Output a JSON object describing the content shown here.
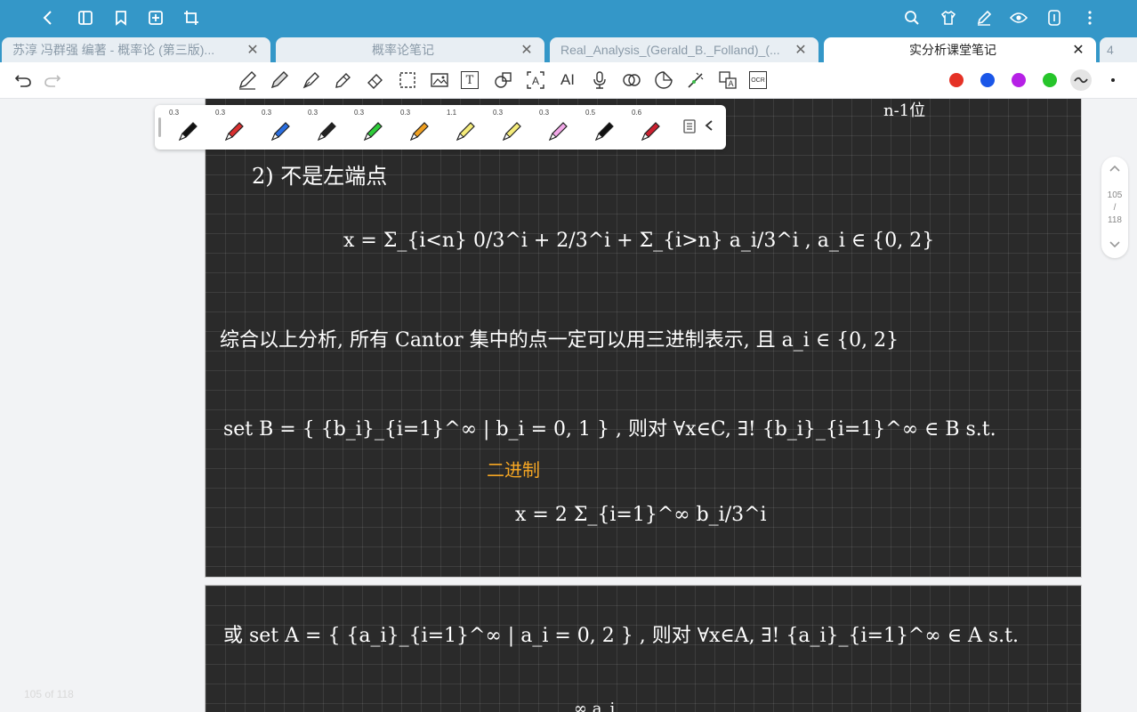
{
  "topbar": {
    "left_icons": [
      "back-icon",
      "book-icon",
      "bookmark-icon",
      "add-page-icon",
      "crop-icon"
    ],
    "right_icons": [
      "search-icon",
      "shirt-icon",
      "pen-icon",
      "eye-icon",
      "split-view-icon",
      "more-icon"
    ]
  },
  "tabs": [
    {
      "label": "苏淳 冯群强 编著 - 概率论 (第三版)...",
      "active": false
    },
    {
      "label": "概率论笔记",
      "active": false
    },
    {
      "label": "Real_Analysis_(Gerald_B._Folland)_(...",
      "active": false
    },
    {
      "label": "实分析课堂笔记",
      "active": true
    }
  ],
  "tab_count": "4",
  "toolbar": {
    "tools": [
      "pencil-icon",
      "pen-icon",
      "fountain-pen-icon",
      "highlighter-icon",
      "eraser-icon",
      "lasso-icon",
      "image-icon",
      "text-icon",
      "shapes-icon",
      "ocr-text-icon",
      "ai-icon",
      "microphone-icon",
      "link-icon",
      "sticker-icon",
      "laser-icon",
      "translate-icon",
      "ocr-icon"
    ],
    "tool_labels": {
      "text": "T",
      "ai": "AI",
      "ocr": "OCR"
    },
    "colors": [
      "#e53125",
      "#1a56e8",
      "#b620e6",
      "#26c52a"
    ]
  },
  "pen_panel": {
    "pens": [
      {
        "size": "0.3",
        "color": "#111111"
      },
      {
        "size": "0.3",
        "color": "#d93030"
      },
      {
        "size": "0.3",
        "color": "#2a6ee0"
      },
      {
        "size": "0.3",
        "color": "#222222"
      },
      {
        "size": "0.3",
        "color": "#2ecc3a"
      },
      {
        "size": "0.3",
        "color": "#f0a020"
      },
      {
        "size": "1.1",
        "color": "#f5ec7a"
      },
      {
        "size": "0.3",
        "color": "#f5ec7a"
      },
      {
        "size": "0.3",
        "color": "#f2a8e8"
      },
      {
        "size": "0.5",
        "color": "#111111"
      },
      {
        "size": "0.6",
        "color": "#cc2030"
      }
    ]
  },
  "scroller": {
    "current": "105",
    "separator": "/",
    "total": "118"
  },
  "page_indicator": "105 of 118",
  "note": {
    "top_fragment": "n-1位",
    "case2": "2) 不是左端点",
    "formula1": "x = Σ_{i<n} 0/3^i + 2/3^i + Σ_{i>n} a_i/3^i ,  a_i ∈ {0, 2}",
    "summary": "综合以上分析, 所有 Cantor 集中的点一定可以用三进制表示, 且 a_i ∈ {0, 2}",
    "set_b": "set  B = { {b_i}_{i=1}^∞ | b_i = 0, 1 } , 则对 ∀x∈C, ∃! {b_i}_{i=1}^∞ ∈ B  s.t.",
    "ternary": "二进制",
    "formula2": "x = 2 Σ_{i=1}^∞ b_i/3^i",
    "set_a": "或 set  A = { {a_i}_{i=1}^∞ | a_i = 0, 2 } , 则对 ∀x∈A, ∃! {a_i}_{i=1}^∞ ∈ A   s.t.",
    "bottom_fragment": "∞   a_i"
  }
}
